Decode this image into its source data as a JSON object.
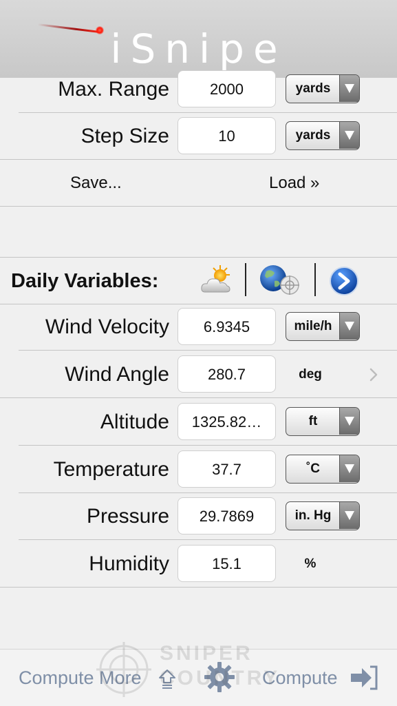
{
  "app": {
    "logo": "iSnipe"
  },
  "settings": {
    "max_range": {
      "label": "Max. Range",
      "value": "2000",
      "unit": "yards"
    },
    "step_size": {
      "label": "Step Size",
      "value": "10",
      "unit": "yards"
    },
    "save_label": "Save...",
    "load_label": "Load »"
  },
  "daily": {
    "title": "Daily Variables:",
    "rows": [
      {
        "label": "Wind Velocity",
        "value": "6.9345",
        "unit": "mile/h"
      },
      {
        "label": "Wind Angle",
        "value": "280.7",
        "unit": "deg"
      },
      {
        "label": "Altitude",
        "value": "1325.82…",
        "unit": "ft"
      },
      {
        "label": "Temperature",
        "value": "37.7",
        "unit": "˚C"
      },
      {
        "label": "Pressure",
        "value": "29.7869",
        "unit": "in. Hg"
      },
      {
        "label": "Humidity",
        "value": "15.1",
        "unit": "%"
      }
    ]
  },
  "footer": {
    "compute_more_label": "Compute More",
    "compute_label": "Compute",
    "watermark": "SNIPER COUNTRY"
  },
  "colors": {
    "header_bg": "#cfcfcf",
    "footer_text": "#7f8fa7",
    "accent_red": "#ff2a1a"
  }
}
